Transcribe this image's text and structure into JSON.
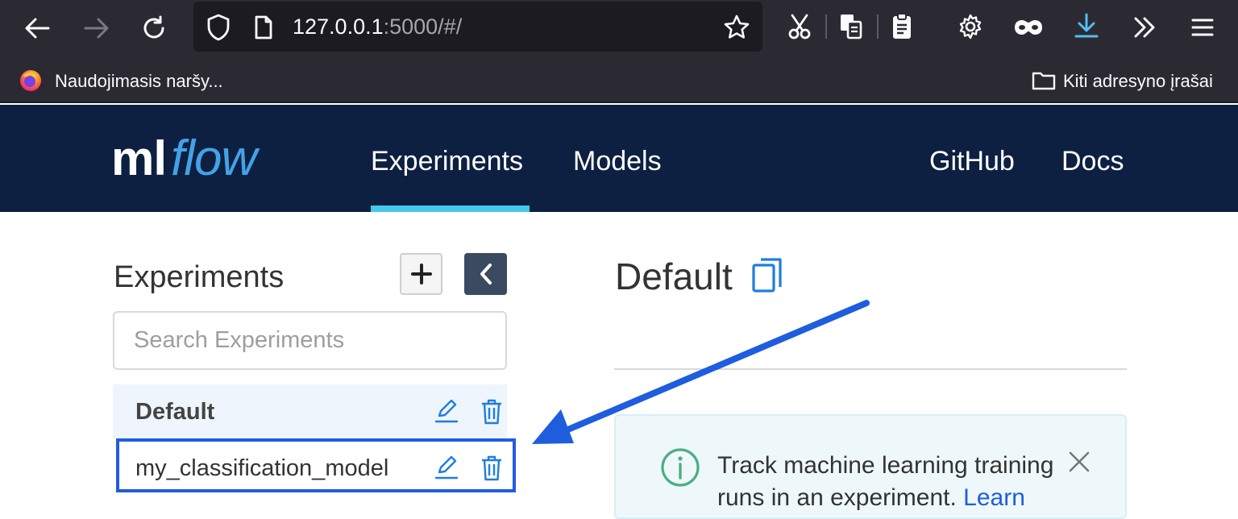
{
  "browser": {
    "url_host": "127.0.0.1",
    "url_rest": ":5000/#/",
    "bookmark_left": "Naudojimasis naršy...",
    "bookmark_right": "Kiti adresyno įrašai"
  },
  "header": {
    "logo_left": "ml",
    "logo_right": "flow",
    "nav": {
      "experiments": "Experiments",
      "models": "Models",
      "github": "GitHub",
      "docs": "Docs"
    }
  },
  "sidebar": {
    "title": "Experiments",
    "search_placeholder": "Search Experiments",
    "experiments": [
      {
        "name": "Default"
      },
      {
        "name": "my_classification_model"
      }
    ]
  },
  "main": {
    "title": "Default",
    "info_text": "Track machine learning training runs in an experiment.",
    "info_link": "Learn"
  },
  "colors": {
    "header_bg": "#0e2041",
    "accent": "#43c9ed",
    "link_blue": "#1f5ddf",
    "info_green": "#4caf82"
  }
}
